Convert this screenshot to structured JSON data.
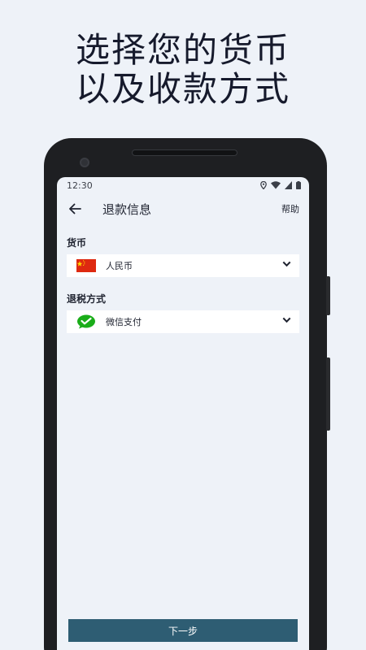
{
  "headline": {
    "line1": "选择您的货币",
    "line2": "以及收款方式"
  },
  "statusbar": {
    "time": "12:30"
  },
  "appbar": {
    "title": "退款信息",
    "help": "帮助"
  },
  "currency": {
    "label": "货币",
    "value": "人民币",
    "flag": "china-flag-icon"
  },
  "payment": {
    "label": "退税方式",
    "value": "微信支付",
    "icon": "wechat-pay-icon"
  },
  "next_button": {
    "label": "下一步"
  },
  "colors": {
    "primary": "#2e5d73",
    "background": "#eef2f8",
    "wechat_green": "#1aad19",
    "flag_red": "#de2910",
    "flag_yellow": "#ffde00"
  }
}
